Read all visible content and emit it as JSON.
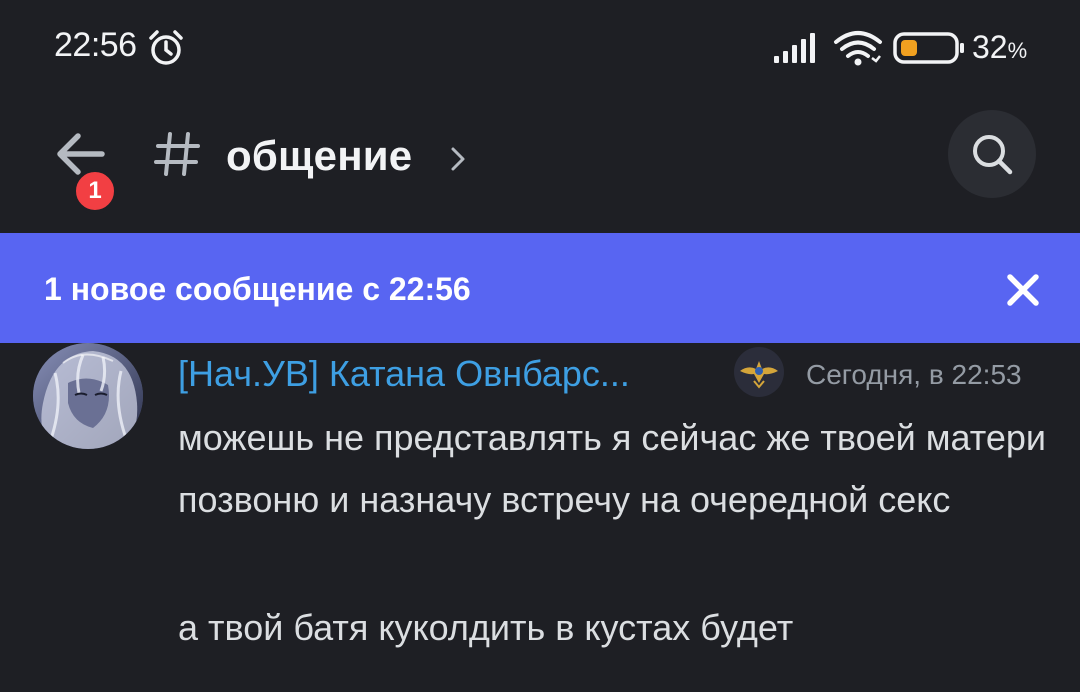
{
  "status_bar": {
    "time": "22:56",
    "battery_percent": "32",
    "battery_unit": "%",
    "battery_level": 0.32,
    "icons": [
      "alarm-icon",
      "signal-icon",
      "wifi-icon",
      "battery-icon"
    ]
  },
  "header": {
    "unread_count": "1",
    "channel_hash": "#",
    "channel_name": "общение",
    "icons": [
      "back-arrow-icon",
      "hash-icon",
      "chevron-right-icon",
      "search-icon"
    ]
  },
  "new_messages_banner": {
    "text": "1 новое сообщение с 22:56",
    "close_icon": "close-icon"
  },
  "message": {
    "author": "[Нач.УВ] Катана Овнбарс...",
    "timestamp": "Сегодня, в 22:53",
    "lines": [
      "можешь не представлять я сейчас же твоей матери позвоню и назначу встречу на очередной секс",
      "а твой батя куколдить в кустах будет"
    ]
  },
  "colors": {
    "background": "#1e1f24",
    "banner": "#5865f2",
    "author": "#3e9fe3",
    "badge": "#f23f43",
    "timestamp": "#949ba4",
    "text": "#dbdee1"
  }
}
